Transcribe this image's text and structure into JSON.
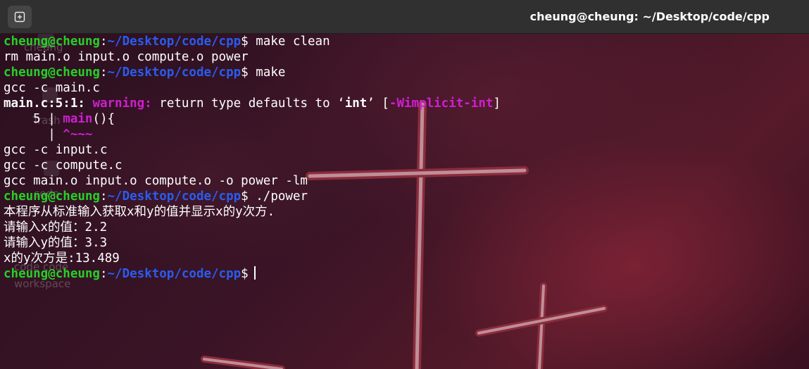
{
  "window": {
    "title": "cheung@cheung: ~/Desktop/code/cpp",
    "new_tab_icon": "new-tab-icon"
  },
  "desktop_background": {
    "labels": [
      "cheung",
      "Trash",
      "code",
      "code code",
      "workspace"
    ],
    "accent": "#8a2c3c"
  },
  "prompt": {
    "user_host": "cheung@cheung",
    "sep": ":",
    "path": "~/Desktop/code/cpp",
    "symbol": "$"
  },
  "terminal": {
    "cmd_make_clean": "make clean",
    "out_rm": "rm main.o input.o compute.o power",
    "cmd_make": "make",
    "out_gcc_main": "gcc -c main.c",
    "warn_loc": "main.c:5:1:",
    "warn_label": "warning:",
    "warn_msg_a": "return type defaults to ‘",
    "warn_int": "int",
    "warn_msg_b": "’ [",
    "warn_flag": "-Wimplicit-int",
    "warn_msg_c": "]",
    "src_gutter": "    5 | ",
    "src_code_hl": "main",
    "src_code_rest": "(){",
    "caret_gutter": "      | ",
    "caret_marks": "^~~~",
    "out_gcc_input": "gcc -c input.c",
    "out_gcc_compute": "gcc -c compute.c",
    "out_gcc_link": "gcc main.o input.o compute.o -o power -lm",
    "cmd_power": "./power",
    "prog_intro": "本程序从标准输入获取x和y的值并显示x的y次方.",
    "prog_ask_x": "请输入x的值：",
    "val_x": "2.2",
    "prog_ask_y": "请输入y的值：",
    "val_y": "3.3",
    "prog_result": "x的y次方是:13.489"
  },
  "colors": {
    "user_host": "#26d026",
    "path": "#2a5cf0",
    "warning": "#d01ed0",
    "titlebar": "#303030"
  }
}
